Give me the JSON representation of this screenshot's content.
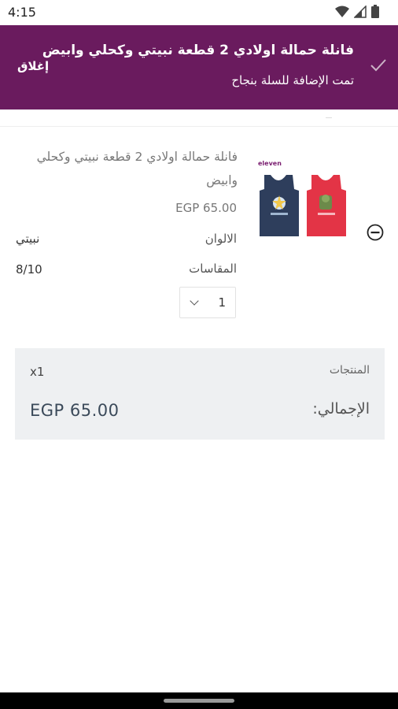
{
  "status_bar": {
    "time": "4:15"
  },
  "banner": {
    "title": "فانلة حمالة اولادي 2 قطعة نبيتي وكحلي وابيض",
    "subtitle": "تمت الإضافة للسلة بنجاح",
    "close_label": "إغلاق"
  },
  "cart_item": {
    "title": "فانلة حمالة اولادي 2 قطعة نبيتي وكحلي وابيض",
    "price": "EGP 65.00",
    "color_label": "الالوان",
    "color_value": "نبيتي",
    "size_label": "المقاسات",
    "size_value": "8/10",
    "quantity": "1",
    "image_brand": "eleven"
  },
  "summary": {
    "products_label": "المنتجات",
    "products_count": "x1",
    "total_label": "الإجمالي:",
    "total_value": "EGP 65.00"
  },
  "colors": {
    "brand": "#6a1b5e",
    "summary_bg": "#eef0f2",
    "navy_shirt": "#2e3e5c",
    "red_shirt": "#e33446"
  }
}
